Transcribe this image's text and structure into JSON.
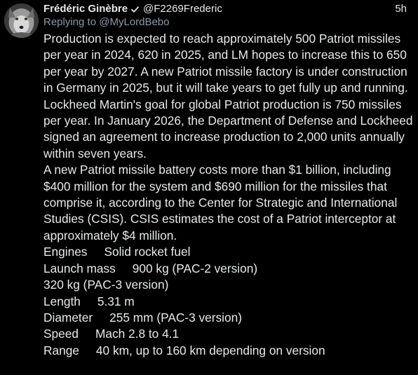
{
  "author": {
    "display_name": "Frédéric Ginèbre",
    "handle": "@F2269Frederic",
    "time": "5h",
    "avatar_icon": "wolf-avatar"
  },
  "reply": {
    "prefix": "Replying to ",
    "mention": "@MyLordBebo"
  },
  "body": {
    "paragraph1": "Production is expected to reach approximately 500 Patriot missiles per year in 2024, 620 in 2025, and LM hopes to increase this to 650 per year by 2027. A new Patriot missile factory is under construction in Germany in 2025, but it will take years to get fully up and running. Lockheed Martin's goal for global Patriot production is 750 missiles per year. In January 2026, the Department of Defense and Lockheed signed an agreement to increase production to 2,000 units annually within seven years.",
    "paragraph2": "A new Patriot missile battery costs more than $1 billion, including $400 million for the system and $690 million for the missiles that comprise it, according to the Center for Strategic and International Studies (CSIS). CSIS estimates the cost of a Patriot interceptor at approximately $4 million.",
    "specs": [
      "Engines     Solid rocket fuel",
      "Launch mass     900 kg (PAC-2 version)",
      "320 kg (PAC-3 version)",
      "Length     5.31 m",
      "Diameter     255 mm (PAC-3 version)",
      "Speed     Mach 2.8 to 4.1",
      "Range     40 km, up to 160 km depending on version"
    ]
  },
  "colors": {
    "background": "#000000",
    "text": "#e7e9ea",
    "secondary": "#8b98a5"
  }
}
